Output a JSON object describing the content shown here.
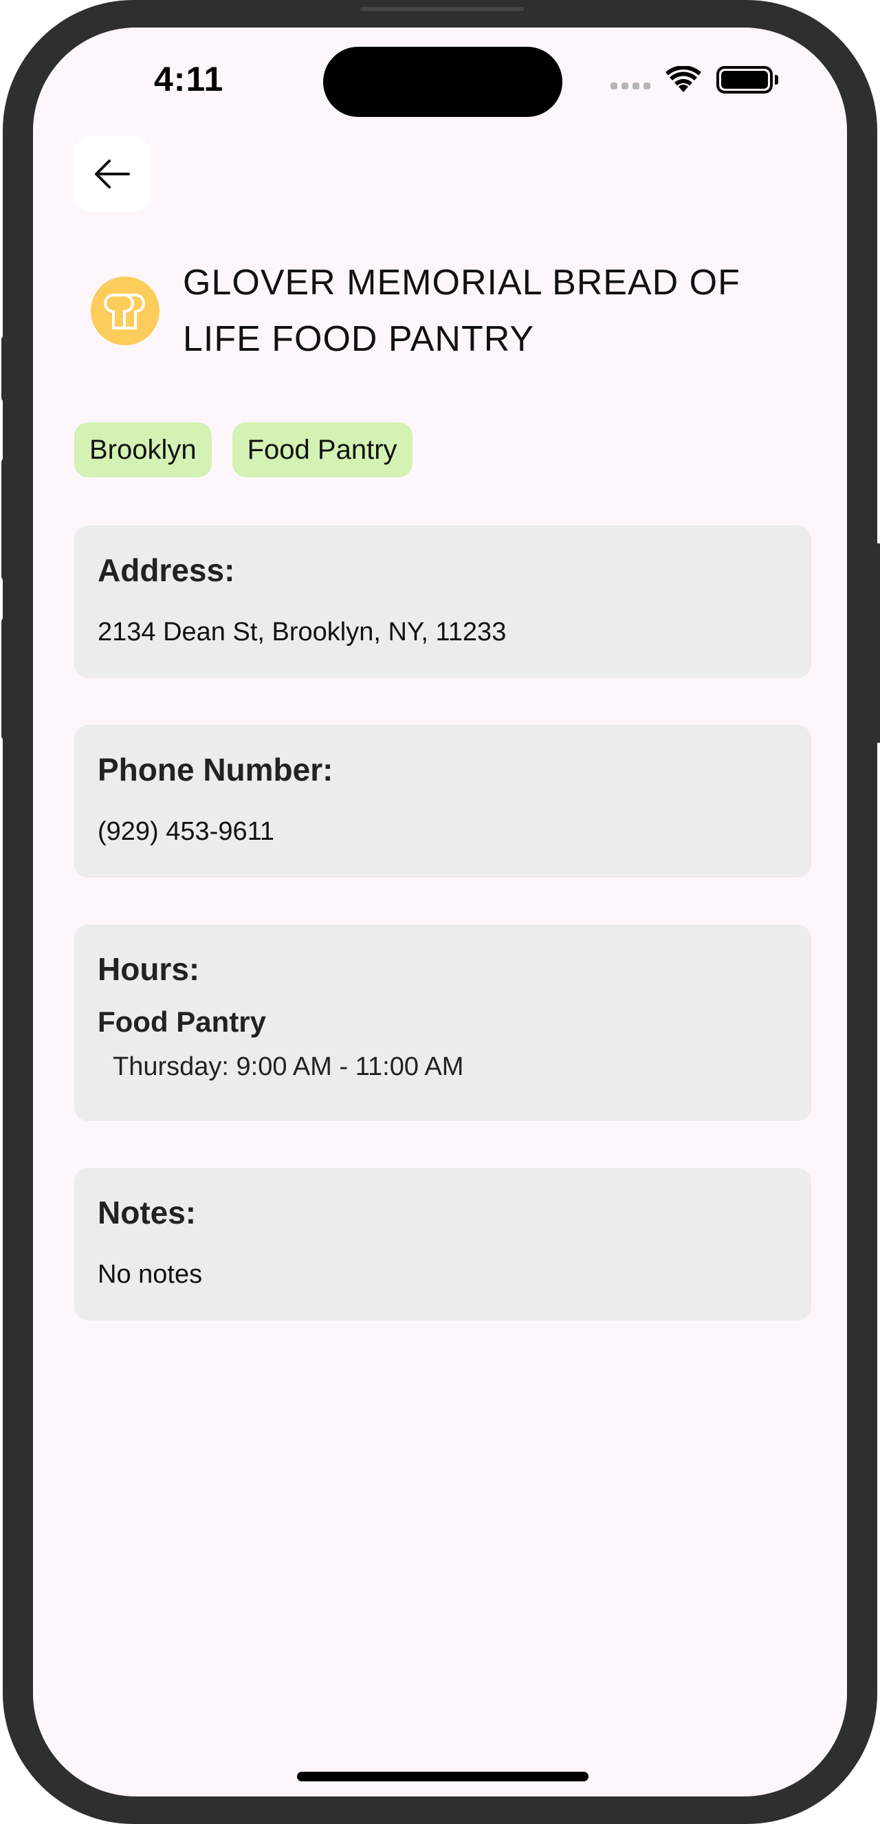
{
  "status_bar": {
    "time": "4:11"
  },
  "nav": {
    "back_icon": "arrow-left-icon"
  },
  "header": {
    "logo_icon": "bread-icon",
    "logo_color": "#fdcd5b",
    "title": "GLOVER MEMORIAL BREAD OF LIFE FOOD PANTRY"
  },
  "tags": [
    {
      "label": "Brooklyn"
    },
    {
      "label": "Food Pantry"
    }
  ],
  "tag_color": "#d3f2b4",
  "address": {
    "label": "Address:",
    "value": "2134 Dean St, Brooklyn, NY, 11233"
  },
  "phone": {
    "label": "Phone Number:",
    "value": "(929) 453-9611"
  },
  "hours": {
    "label": "Hours:",
    "category": "Food Pantry",
    "entries": [
      {
        "text": "Thursday: 9:00 AM - 11:00 AM"
      }
    ]
  },
  "notes": {
    "label": "Notes:",
    "value": "No notes"
  }
}
